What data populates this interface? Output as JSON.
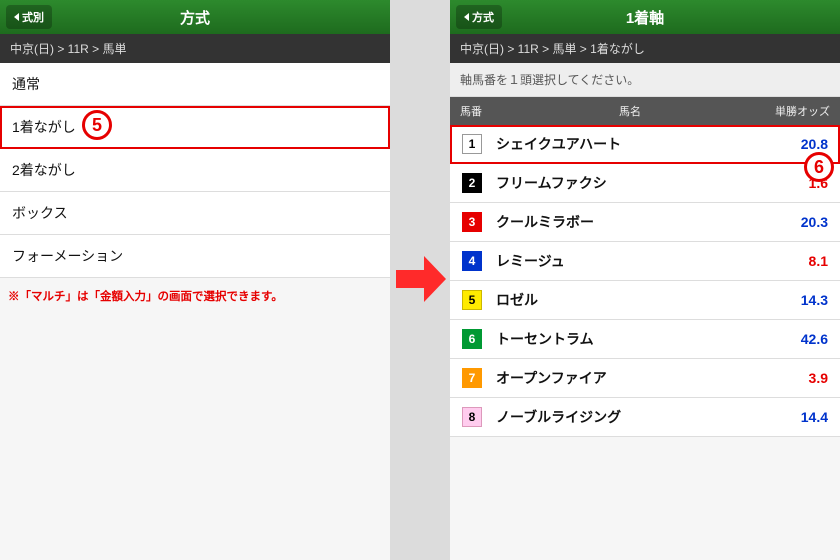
{
  "left": {
    "back": "式別",
    "title": "方式",
    "breadcrumb": "中京(日) > 11R > 馬単",
    "options": [
      {
        "label": "通常",
        "hl": false
      },
      {
        "label": "1着ながし",
        "hl": true
      },
      {
        "label": "2着ながし",
        "hl": false
      },
      {
        "label": "ボックス",
        "hl": false
      },
      {
        "label": "フォーメーション",
        "hl": false
      }
    ],
    "note": "※「マルチ」は「金額入力」の画面で選択できます。"
  },
  "right": {
    "back": "方式",
    "title": "1着軸",
    "breadcrumb": "中京(日) > 11R > 馬単 > 1着ながし",
    "instruction": "軸馬番を１頭選択してください。",
    "columns": {
      "num": "馬番",
      "name": "馬名",
      "odds": "単勝オッズ"
    },
    "horses": [
      {
        "num": "1",
        "name": "シェイクユアハート",
        "odds": "20.8",
        "oddsColor": "blue",
        "hl": true
      },
      {
        "num": "2",
        "name": "フリームファクシ",
        "odds": "1.6",
        "oddsColor": "red",
        "hl": false
      },
      {
        "num": "3",
        "name": "クールミラボー",
        "odds": "20.3",
        "oddsColor": "blue",
        "hl": false
      },
      {
        "num": "4",
        "name": "レミージュ",
        "odds": "8.1",
        "oddsColor": "red",
        "hl": false
      },
      {
        "num": "5",
        "name": "ロゼル",
        "odds": "14.3",
        "oddsColor": "blue",
        "hl": false
      },
      {
        "num": "6",
        "name": "トーセントラム",
        "odds": "42.6",
        "oddsColor": "blue",
        "hl": false
      },
      {
        "num": "7",
        "name": "オープンファイア",
        "odds": "3.9",
        "oddsColor": "red",
        "hl": false
      },
      {
        "num": "8",
        "name": "ノーブルライジング",
        "odds": "14.4",
        "oddsColor": "blue",
        "hl": false
      }
    ]
  },
  "annotations": {
    "step5": "5",
    "step6": "6"
  }
}
